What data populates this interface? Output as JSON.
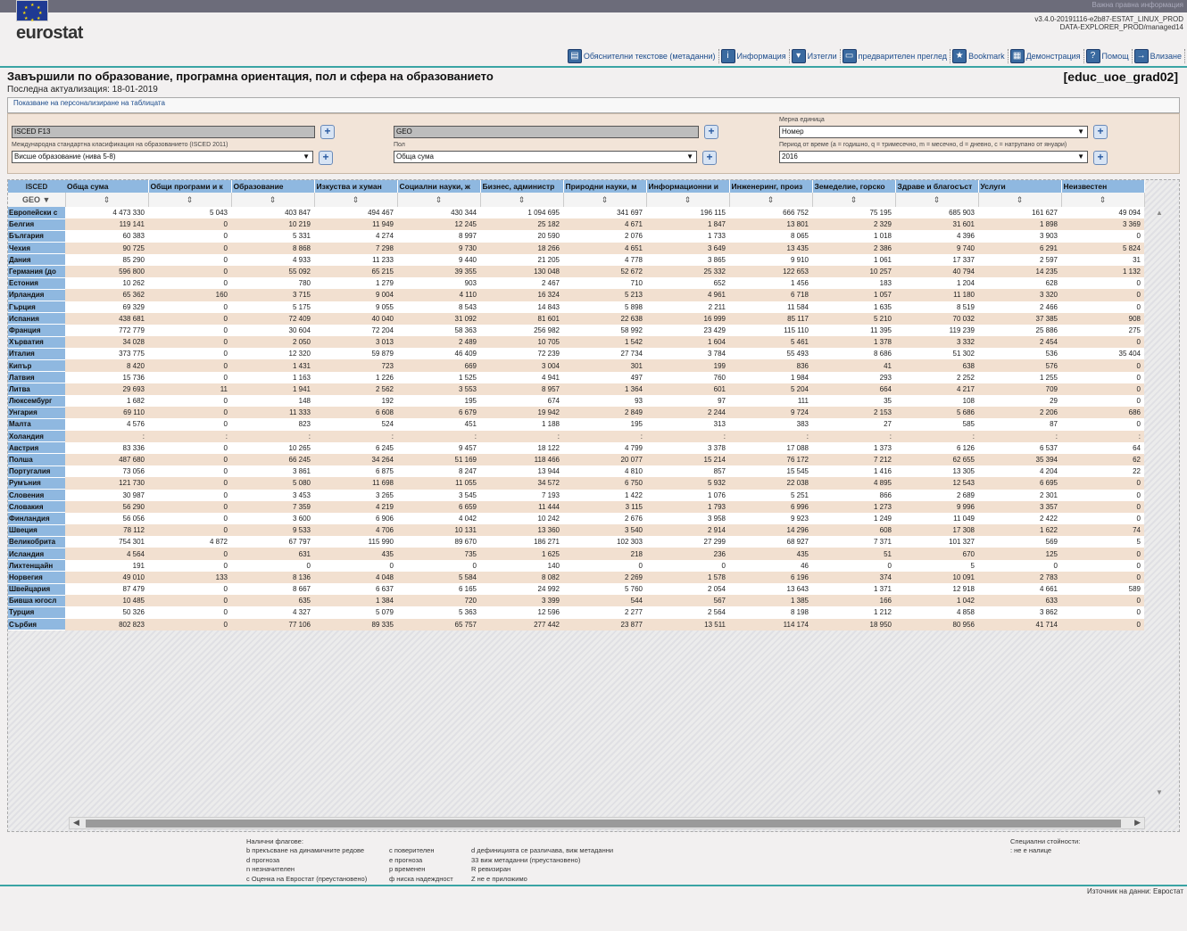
{
  "header": {
    "top_link": "Важна правна информация",
    "logo_text": "eurostat",
    "version_line1": "v3.4.0-20191116-e2b87-ESTAT_LINUX_PROD",
    "version_line2": "DATA-EXPLORER_PROD/managed14"
  },
  "toolbar": [
    {
      "label": "Обяснителни текстове (метаданни)",
      "icon": "metadata-icon"
    },
    {
      "label": "Информация",
      "icon": "info-icon"
    },
    {
      "label": "Изтегли",
      "icon": "download-icon"
    },
    {
      "label": "предварителен преглед",
      "icon": "print-preview-icon"
    },
    {
      "label": "Bookmark",
      "icon": "bookmark-icon"
    },
    {
      "label": "Демонстрация",
      "icon": "demo-icon"
    },
    {
      "label": "Помощ",
      "icon": "help-icon"
    },
    {
      "label": "Влизане",
      "icon": "login-icon"
    }
  ],
  "page": {
    "title": "Завършили по образование, програмна ориентация, пол и сфера на образованието",
    "code": "[educ_uoe_grad02]",
    "last_update": "Последна актуализация: 18-01-2019",
    "show_link": "Показване на персонализиране на таблицата"
  },
  "filters": {
    "isced_box": "ISCED F13",
    "geo_box": "GEO",
    "unit_label": "Мерна единица",
    "unit_value": "Номер",
    "level_label": "Международна стандартна класификация на образованието (ISCED 2011)",
    "level_value": "Висше образование (нива 5-8)",
    "sex_label": "Пол",
    "sex_value": "Обща сума",
    "period_label": "Период от време (a = годишно, q = тримесечно, m = месечно, d = дневно, c = натрупано от януари)",
    "period_value": "2016"
  },
  "grid": {
    "corner_top": "ISCED",
    "corner_geo": "GEO",
    "columns": [
      "Обща сума",
      "Общи програми и к",
      "Образование",
      "Изкуства и хуман",
      "Социални науки, ж",
      "Бизнес, администр",
      "Природни науки, м",
      "Информационни и",
      "Инженеринг, произ",
      "Земеделие, горско",
      "Здраве и благосъст",
      "Услуги",
      "Неизвестен"
    ],
    "rows": [
      {
        "geo": "Европейски с",
        "vals": [
          "4 473 330",
          "5 043",
          "403 847",
          "494 467",
          "430 344",
          "1 094 695",
          "341 697",
          "196 115",
          "666 752",
          "75 195",
          "685 903",
          "161 627",
          "49 094"
        ]
      },
      {
        "geo": "Белгия",
        "vals": [
          "119 141",
          "0",
          "10 219",
          "11 949",
          "12 245",
          "25 182",
          "4 671",
          "1 847",
          "13 801",
          "2 329",
          "31 601",
          "1 898",
          "3 369"
        ]
      },
      {
        "geo": "България",
        "vals": [
          "60 383",
          "0",
          "5 331",
          "4 274",
          "8 997",
          "20 590",
          "2 076",
          "1 733",
          "8 065",
          "1 018",
          "4 396",
          "3 903",
          "0"
        ]
      },
      {
        "geo": "Чехия",
        "vals": [
          "90 725",
          "0",
          "8 868",
          "7 298",
          "9 730",
          "18 266",
          "4 651",
          "3 649",
          "13 435",
          "2 386",
          "9 740",
          "6 291",
          "5 824"
        ]
      },
      {
        "geo": "Дания",
        "vals": [
          "85 290",
          "0",
          "4 933",
          "11 233",
          "9 440",
          "21 205",
          "4 778",
          "3 865",
          "9 910",
          "1 061",
          "17 337",
          "2 597",
          "31"
        ]
      },
      {
        "geo": "Германия (до",
        "vals": [
          "596 800",
          "0",
          "55 092",
          "65 215",
          "39 355",
          "130 048",
          "52 672",
          "25 332",
          "122 653",
          "10 257",
          "40 794",
          "14 235",
          "1 132"
        ]
      },
      {
        "geo": "Естония",
        "vals": [
          "10 262",
          "0",
          "780",
          "1 279",
          "903",
          "2 467",
          "710",
          "652",
          "1 456",
          "183",
          "1 204",
          "628",
          "0"
        ]
      },
      {
        "geo": "Ирландия",
        "vals": [
          "65 362",
          "160",
          "3 715",
          "9 004",
          "4 110",
          "16 324",
          "5 213",
          "4 961",
          "6 718",
          "1 057",
          "11 180",
          "3 320",
          "0"
        ]
      },
      {
        "geo": "Гърция",
        "vals": [
          "69 329",
          "0",
          "5 175",
          "9 055",
          "8 543",
          "14 843",
          "5 898",
          "2 211",
          "11 584",
          "1 635",
          "8 519",
          "2 466",
          "0"
        ]
      },
      {
        "geo": "Испания",
        "vals": [
          "438 681",
          "0",
          "72 409",
          "40 040",
          "31 092",
          "81 601",
          "22 638",
          "16 999",
          "85 117",
          "5 210",
          "70 032",
          "37 385",
          "908"
        ]
      },
      {
        "geo": "Франция",
        "vals": [
          "772 779",
          "0",
          "30 604",
          "72 204",
          "58 363",
          "256 982",
          "58 992",
          "23 429",
          "115 110",
          "11 395",
          "119 239",
          "25 886",
          "275"
        ]
      },
      {
        "geo": "Хърватия",
        "vals": [
          "34 028",
          "0",
          "2 050",
          "3 013",
          "2 489",
          "10 705",
          "1 542",
          "1 604",
          "5 461",
          "1 378",
          "3 332",
          "2 454",
          "0"
        ]
      },
      {
        "geo": "Италия",
        "vals": [
          "373 775",
          "0",
          "12 320",
          "59 879",
          "46 409",
          "72 239",
          "27 734",
          "3 784",
          "55 493",
          "8 686",
          "51 302",
          "536",
          "35 404"
        ]
      },
      {
        "geo": "Кипър",
        "vals": [
          "8 420",
          "0",
          "1 431",
          "723",
          "669",
          "3 004",
          "301",
          "199",
          "836",
          "41",
          "638",
          "576",
          "0"
        ]
      },
      {
        "geo": "Латвия",
        "vals": [
          "15 736",
          "0",
          "1 163",
          "1 226",
          "1 525",
          "4 941",
          "497",
          "760",
          "1 984",
          "293",
          "2 252",
          "1 255",
          "0"
        ]
      },
      {
        "geo": "Литва",
        "vals": [
          "29 693",
          "11",
          "1 941",
          "2 562",
          "3 553",
          "8 957",
          "1 364",
          "601",
          "5 204",
          "664",
          "4 217",
          "709",
          "0"
        ]
      },
      {
        "geo": "Люксембург",
        "vals": [
          "1 682",
          "0",
          "148",
          "192",
          "195",
          "674",
          "93",
          "97",
          "111",
          "35",
          "108",
          "29",
          "0"
        ]
      },
      {
        "geo": "Унгария",
        "vals": [
          "69 110",
          "0",
          "11 333",
          "6 608",
          "6 679",
          "19 942",
          "2 849",
          "2 244",
          "9 724",
          "2 153",
          "5 686",
          "2 206",
          "686"
        ]
      },
      {
        "geo": "Малта",
        "vals": [
          "4 576",
          "0",
          "823",
          "524",
          "451",
          "1 188",
          "195",
          "313",
          "383",
          "27",
          "585",
          "87",
          "0"
        ]
      },
      {
        "geo": "Холандия",
        "vals": [
          ":",
          ":",
          ":",
          ":",
          ":",
          ":",
          ":",
          ":",
          ":",
          ":",
          ":",
          ":",
          ":"
        ]
      },
      {
        "geo": "Австрия",
        "vals": [
          "83 336",
          "0",
          "10 265",
          "6 245",
          "9 457",
          "18 122",
          "4 799",
          "3 378",
          "17 088",
          "1 373",
          "6 126",
          "6 537",
          "64"
        ]
      },
      {
        "geo": "Полша",
        "vals": [
          "487 680",
          "0",
          "66 245",
          "34 264",
          "51 169",
          "118 466",
          "20 077",
          "15 214",
          "76 172",
          "7 212",
          "62 655",
          "35 394",
          "62"
        ]
      },
      {
        "geo": "Португалия",
        "vals": [
          "73 056",
          "0",
          "3 861",
          "6 875",
          "8 247",
          "13 944",
          "4 810",
          "857",
          "15 545",
          "1 416",
          "13 305",
          "4 204",
          "22"
        ]
      },
      {
        "geo": "Румъния",
        "vals": [
          "121 730",
          "0",
          "5 080",
          "11 698",
          "11 055",
          "34 572",
          "6 750",
          "5 932",
          "22 038",
          "4 895",
          "12 543",
          "6 695",
          "0"
        ]
      },
      {
        "geo": "Словения",
        "vals": [
          "30 987",
          "0",
          "3 453",
          "3 265",
          "3 545",
          "7 193",
          "1 422",
          "1 076",
          "5 251",
          "866",
          "2 689",
          "2 301",
          "0"
        ]
      },
      {
        "geo": "Словакия",
        "vals": [
          "56 290",
          "0",
          "7 359",
          "4 219",
          "6 659",
          "11 444",
          "3 115",
          "1 793",
          "6 996",
          "1 273",
          "9 996",
          "3 357",
          "0"
        ]
      },
      {
        "geo": "Финландия",
        "vals": [
          "56 056",
          "0",
          "3 600",
          "6 906",
          "4 042",
          "10 242",
          "2 676",
          "3 958",
          "9 923",
          "1 249",
          "11 049",
          "2 422",
          "0"
        ]
      },
      {
        "geo": "Швеция",
        "vals": [
          "78 112",
          "0",
          "9 533",
          "4 706",
          "10 131",
          "13 360",
          "3 540",
          "2 914",
          "14 296",
          "608",
          "17 308",
          "1 622",
          "74"
        ]
      },
      {
        "geo": "Великобрита",
        "vals": [
          "754 301",
          "4 872",
          "67 797",
          "115 990",
          "89 670",
          "186 271",
          "102 303",
          "27 299",
          "68 927",
          "7 371",
          "101 327",
          "569",
          "5"
        ]
      },
      {
        "geo": "Исландия",
        "vals": [
          "4 564",
          "0",
          "631",
          "435",
          "735",
          "1 625",
          "218",
          "236",
          "435",
          "51",
          "670",
          "125",
          "0"
        ]
      },
      {
        "geo": "Лихтенщайн",
        "vals": [
          "191",
          "0",
          "0",
          "0",
          "0",
          "140",
          "0",
          "0",
          "46",
          "0",
          "5",
          "0",
          "0"
        ]
      },
      {
        "geo": "Норвегия",
        "vals": [
          "49 010",
          "133",
          "8 136",
          "4 048",
          "5 584",
          "8 082",
          "2 269",
          "1 578",
          "6 196",
          "374",
          "10 091",
          "2 783",
          "0"
        ]
      },
      {
        "geo": "Швейцария",
        "vals": [
          "87 479",
          "0",
          "8 667",
          "6 637",
          "6 165",
          "24 992",
          "5 760",
          "2 054",
          "13 643",
          "1 371",
          "12 918",
          "4 661",
          "589"
        ]
      },
      {
        "geo": "Бивша югосл",
        "vals": [
          "10 485",
          "0",
          "635",
          "1 384",
          "720",
          "3 399",
          "544",
          "567",
          "1 385",
          "166",
          "1 042",
          "633",
          "0"
        ]
      },
      {
        "geo": "Турция",
        "vals": [
          "50 326",
          "0",
          "4 327",
          "5 079",
          "5 363",
          "12 596",
          "2 277",
          "2 564",
          "8 198",
          "1 212",
          "4 858",
          "3 862",
          "0"
        ]
      },
      {
        "geo": "Сърбия",
        "vals": [
          "802 823",
          "0",
          "77 106",
          "89 335",
          "65 757",
          "277 442",
          "23 877",
          "13 511",
          "114 174",
          "18 950",
          "80 956",
          "41 714",
          "0"
        ]
      }
    ]
  },
  "legend": {
    "title": "Налични флагове:",
    "col1": [
      "b прекъсване на динамичните редове",
      "d прогноза",
      "n незначителен",
      "c Оценка на Евростат (преустановено)"
    ],
    "col2": [
      "c поверителен",
      "e прогноза",
      "p временен",
      "ф ниска надеждност"
    ],
    "col3": [
      "d дефиницията се различава, виж метаданни",
      "33 виж метаданни (преустановено)",
      "R ревизиран",
      "Z не е приложимо"
    ],
    "special_title": "Специални стойности:",
    "special_item": ":  не е налице"
  },
  "footer": {
    "source": "Източник на данни: Евростат"
  }
}
